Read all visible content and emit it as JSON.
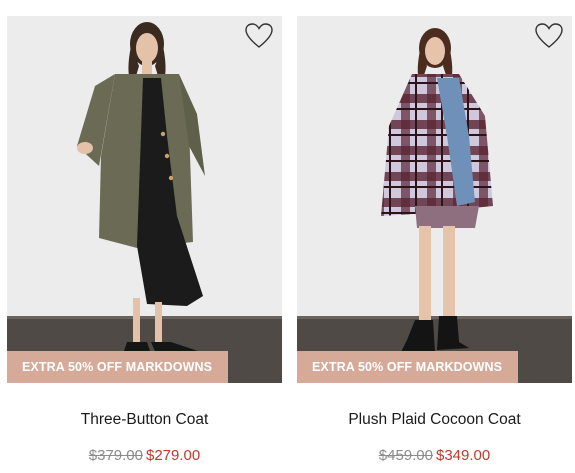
{
  "products": [
    {
      "name": "Three-Button Coat",
      "badge": "EXTRA 50% OFF MARKDOWNS",
      "original_price": "$379.00",
      "sale_price": "$279.00",
      "icon": "heart-outline-icon"
    },
    {
      "name": "Plush Plaid Cocoon Coat",
      "badge": "EXTRA 50% OFF MARKDOWNS",
      "original_price": "$459.00",
      "sale_price": "$349.00",
      "icon": "heart-outline-icon"
    }
  ],
  "colors": {
    "badge_bg": "#d6aa98",
    "sale_price": "#c0392b",
    "original_price": "#8c8c8c",
    "wall": "#ececec",
    "floor": "#4f4a46"
  }
}
